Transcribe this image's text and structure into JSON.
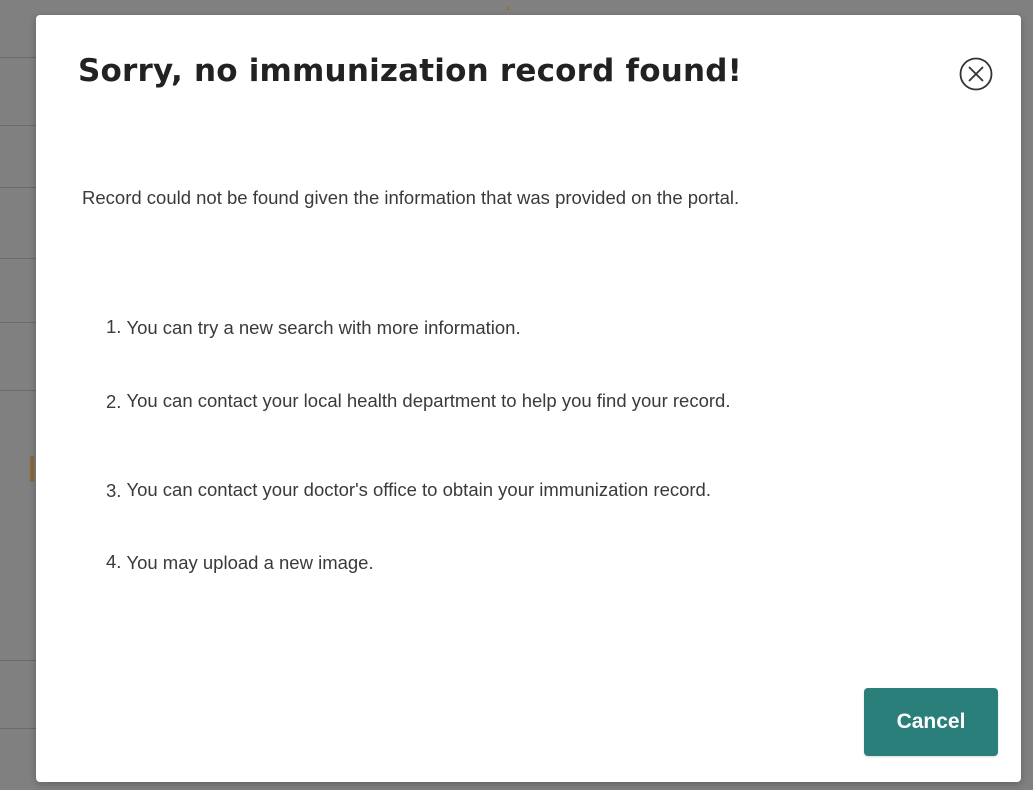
{
  "dialog": {
    "title": "Sorry, no immunization record found!",
    "close_icon": "close-circle-icon",
    "message": "Record could not be found given the information that was provided on the portal.",
    "steps": [
      {
        "number": "1.",
        "text": "You can try a new search with more information."
      },
      {
        "number": "2.",
        "text": "You can contact your local health department to help you find your record."
      },
      {
        "number": "3.",
        "text": "You can contact your doctor's office to obtain your immunization record."
      },
      {
        "number": "4.",
        "text": "You may upload a new image."
      }
    ],
    "cancel_label": "Cancel"
  },
  "colors": {
    "overlay": "#808080",
    "dialog_background": "#ffffff",
    "title_text": "#222222",
    "body_text": "#3a3a3a",
    "primary_button": "#2a7f7a",
    "primary_button_text": "#ffffff"
  }
}
